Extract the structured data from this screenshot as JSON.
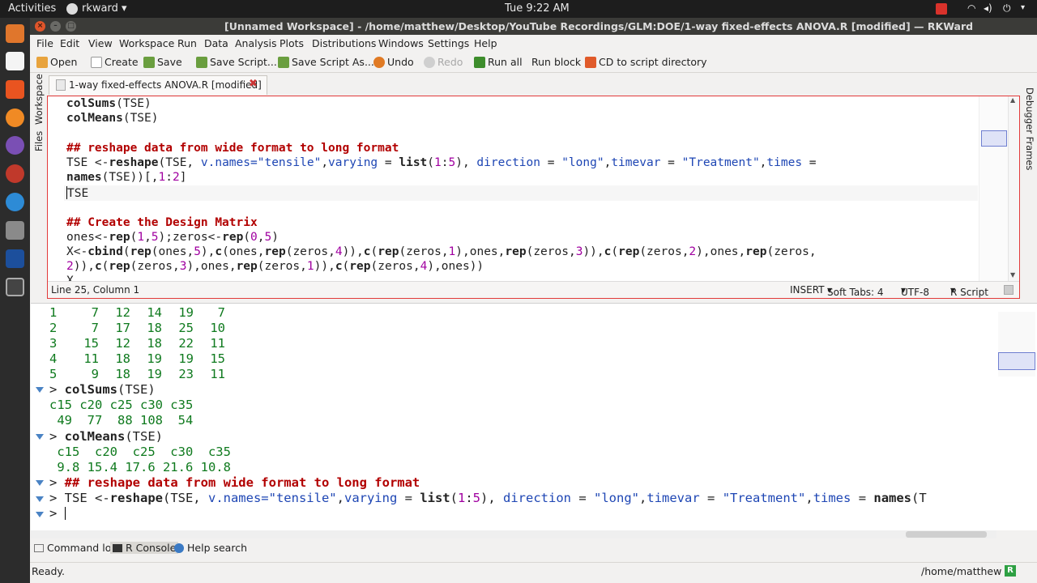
{
  "topbar": {
    "activities": "Activities",
    "app_menu": "rkward",
    "clock": "Tue  9:22 AM"
  },
  "window": {
    "title": "[Unnamed Workspace] - /home/matthew/Desktop/YouTube Recordings/GLM:DOE/1-way fixed-effects ANOVA.R [modified] — RKWard"
  },
  "menu": [
    "File",
    "Edit",
    "View",
    "Workspace",
    "Run",
    "Data",
    "Analysis",
    "Plots",
    "Distributions",
    "Windows",
    "Settings",
    "Help"
  ],
  "toolbar": {
    "open": "Open",
    "create": "Create",
    "save": "Save",
    "save_script": "Save Script...",
    "save_script_as": "Save Script As...",
    "undo": "Undo",
    "redo": "Redo",
    "run_all": "Run all",
    "run_block": "Run block",
    "cd": "CD to script directory"
  },
  "side": {
    "workspace": "Workspace",
    "files": "Files",
    "debugger": "Debugger Frames"
  },
  "editor": {
    "tab": "1-way fixed-effects ANOVA.R [modified]",
    "status": {
      "position": "Line 25, Column 1",
      "mode": "INSERT",
      "tabs": "Soft Tabs: 4",
      "encoding": "UTF-8",
      "syntax": "R Script"
    }
  },
  "console_rows": [
    [
      "1",
      "7",
      "12",
      "14",
      "19",
      "7"
    ],
    [
      "2",
      "7",
      "17",
      "18",
      "25",
      "10"
    ],
    [
      "3",
      "15",
      "12",
      "18",
      "22",
      "11"
    ],
    [
      "4",
      "11",
      "18",
      "19",
      "19",
      "15"
    ],
    [
      "5",
      "9",
      "18",
      "19",
      "23",
      "11"
    ]
  ],
  "console": {
    "colsums_header": "c15 c20 c25 c30 c35",
    "colsums_values": " 49  77  88 108  54",
    "colmeans_header": " c15  c20  c25  c30  c35",
    "colmeans_values": " 9.8 15.4 17.6 21.6 10.8"
  },
  "bottom_tabs": {
    "command_log": "Command log",
    "r_console": "R Console",
    "help_search": "Help search"
  },
  "status": {
    "left": "Ready.",
    "right": "/home/matthew",
    "r_badge": "R"
  },
  "colors": {
    "accent_red": "#e23a3a",
    "output_green": "#0f7a1e",
    "comment_red": "#b20000",
    "string_blue": "#1e46b4"
  }
}
